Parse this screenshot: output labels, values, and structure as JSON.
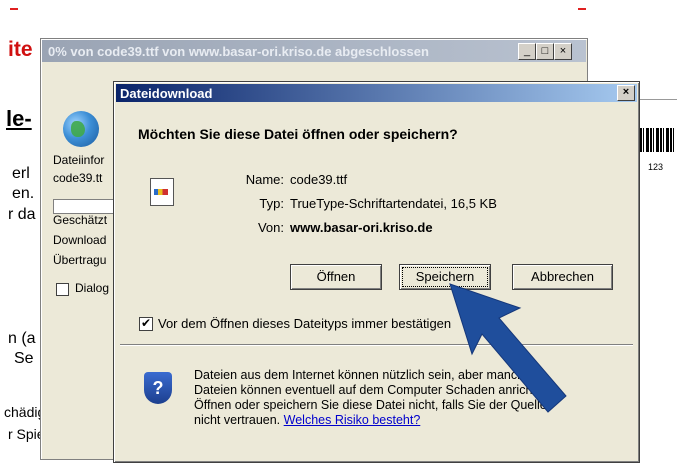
{
  "background_page": {
    "red_heading_fragment": "ite",
    "heading_fragment": "le-",
    "left_fragments": [
      "erl",
      "en.",
      "r da"
    ],
    "mid_fragments": [
      "n (a",
      "Se"
    ],
    "bottom_fragments": [
      "chädigt wird",
      "r Spielsachen,"
    ],
    "barcode_number": "123"
  },
  "progress_window": {
    "title": "0% von code39.ttf von www.basar-ori.kriso.de abgeschlossen",
    "controls": [
      "_",
      "□",
      "×"
    ],
    "lines": [
      "Dateiinfor",
      "code39.tt",
      "Geschätzt",
      "Download",
      "Übertragu"
    ],
    "checkbox_label": "Dialog"
  },
  "dialog": {
    "title": "Dateidownload",
    "close_glyph": "×",
    "question": "Möchten Sie diese Datei öffnen oder speichern?",
    "name_label": "Name:",
    "name_value": "code39.ttf",
    "type_label": "Typ:",
    "type_value": "TrueType-Schriftartendatei, 16,5 KB",
    "from_label": "Von:",
    "from_value": "www.basar-ori.kriso.de",
    "buttons": {
      "open": "Öffnen",
      "save": "Speichern",
      "cancel": "Abbrechen"
    },
    "checkbox_checked": true,
    "checkbox_mark": "✔",
    "checkbox_label": "Vor dem Öffnen dieses Dateityps immer bestätigen",
    "info_lines": [
      "Dateien aus dem Internet können nützlich sein, aber manche",
      "Dateien können eventuell auf dem Computer Schaden anrichten.",
      "Öffnen oder speichern Sie diese Datei nicht, falls Sie der Quelle",
      "nicht vertrauen."
    ],
    "info_link": "Welches Risiko besteht?",
    "shield_glyph": "?"
  },
  "colors": {
    "dialog_title_start": "#0a246a",
    "dialog_title_end": "#a6caf0",
    "arrow": "#1f4e9c",
    "link": "#0000cc"
  },
  "icons": [
    "globe-icon",
    "file-type-icon",
    "security-shield-icon",
    "pointer-arrow"
  ]
}
